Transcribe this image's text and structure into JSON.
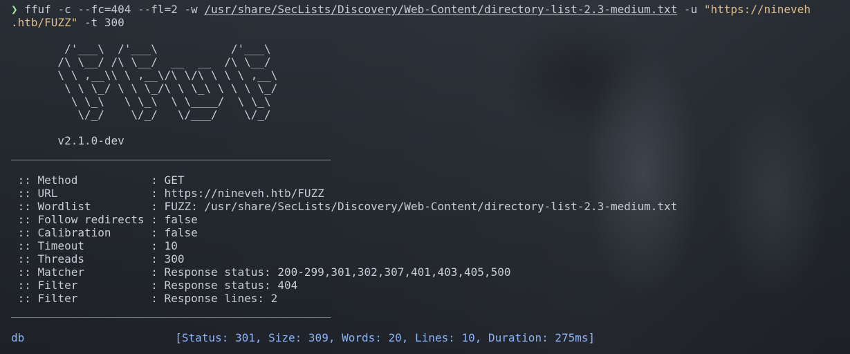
{
  "command": {
    "prompt_symbol": "❯",
    "prefix": " ffuf -c --fc=404 --fl=2 -w ",
    "wordlist_path": "/usr/share/SecLists/Discovery/Web-Content/directory-list-2.3-medium.txt",
    "url_flag": " -u ",
    "url_part1": "\"https://nineveh",
    "url_part2": ".htb/FUZZ\"",
    "threads_flag": " -t 300"
  },
  "banner": {
    "lines": [
      "        /'___\\  /'___\\           /'___\\",
      "       /\\ \\__/ /\\ \\__/  __  __  /\\ \\__/",
      "       \\ \\ ,__\\\\ \\ ,__\\/\\ \\/\\ \\ \\ \\ ,__\\",
      "        \\ \\ \\_/ \\ \\ \\_/\\ \\ \\_\\ \\ \\ \\ \\_/",
      "         \\ \\_\\   \\ \\_\\  \\ \\____/  \\ \\_\\",
      "          \\/_/    \\/_/   \\/___/    \\/_/"
    ],
    "version": "       v2.1.0-dev"
  },
  "rule": "________________________________________________",
  "config": [
    " :: Method           : GET",
    " :: URL              : https://nineveh.htb/FUZZ",
    " :: Wordlist         : FUZZ: /usr/share/SecLists/Discovery/Web-Content/directory-list-2.3-medium.txt",
    " :: Follow redirects : false",
    " :: Calibration      : false",
    " :: Timeout          : 10",
    " :: Threads          : 300",
    " :: Matcher          : Response status: 200-299,301,302,307,401,403,405,500",
    " :: Filter           : Response status: 404",
    " :: Filter           : Response lines: 2"
  ],
  "result": {
    "path": "db",
    "meta": "[Status: 301, Size: 309, Words: 20, Lines: 10, Duration: 275ms]"
  }
}
